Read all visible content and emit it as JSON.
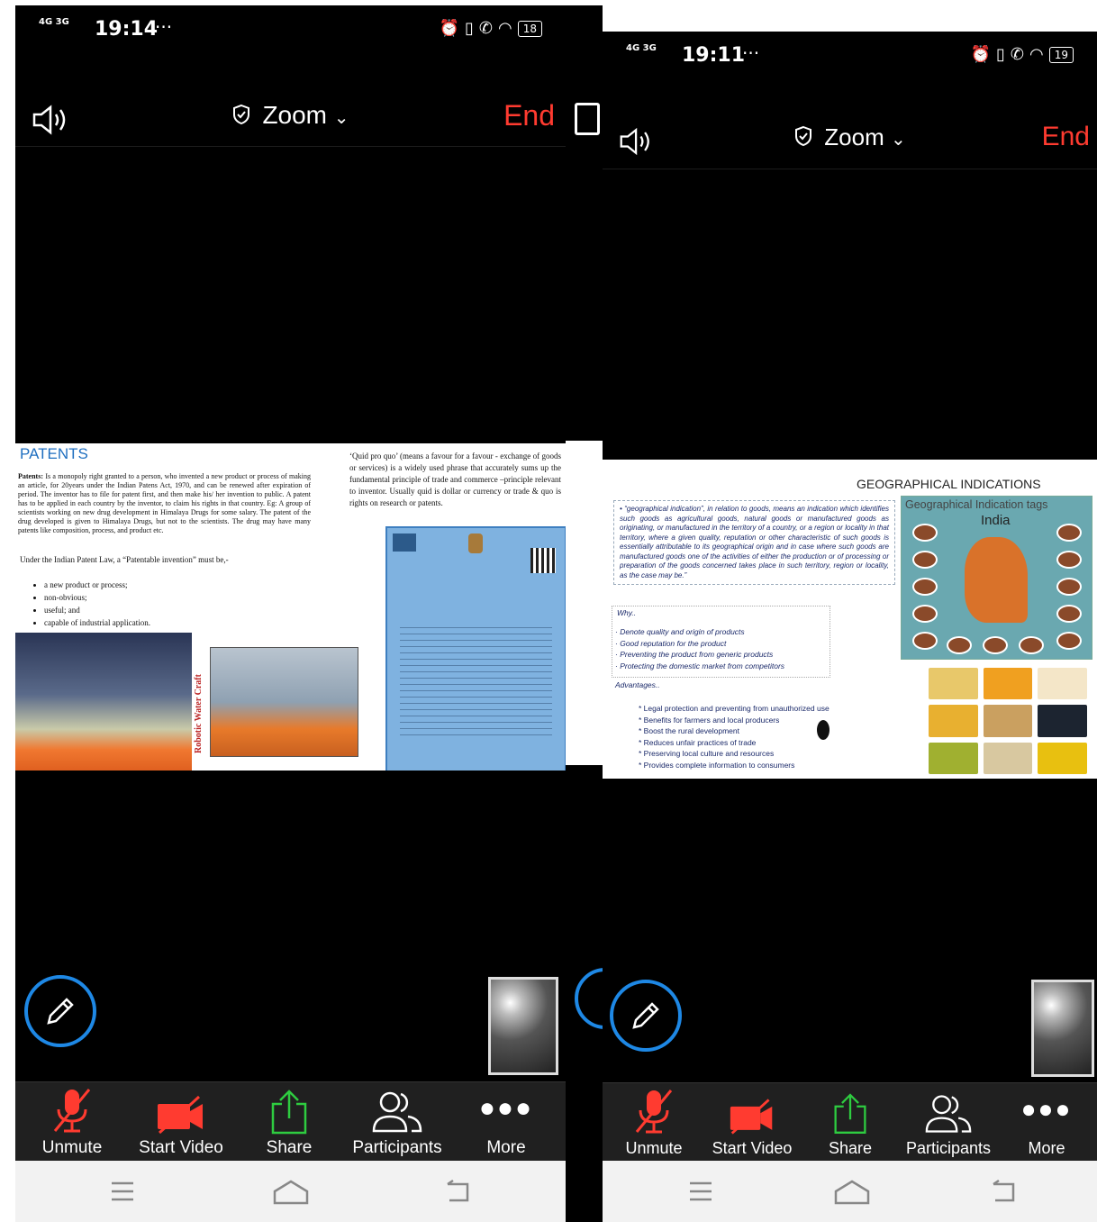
{
  "left_screen": {
    "status": {
      "network": [
        "4G",
        "3G"
      ],
      "time": "19:14",
      "more": "···",
      "battery": "18"
    },
    "meeting": {
      "title": "Zoom",
      "end_label": "End"
    },
    "slide": {
      "title": "PATENTS",
      "paragraph_label": "Patents:",
      "paragraph": "Is a monopoly right granted to a person, who invented a new product or process of making an article, for 20years under the Indian Patens Act, 1970, and can be renewed after expiration of period. The inventor has to file for patent first, and then make his/ her invention to public. A patent has to be applied in each country by the inventor, to claim his rights in that country. Eg: A group of scientists working on new drug development in Himalaya Drugs for some salary. The patent of the drug developed is given to Himalaya Drugs, but not to the scientists. The drug may have many patents like composition, process, and product etc.",
      "under_text": "Under the Indian Patent Law, a “Patentable invention” must be,-",
      "criteria": [
        "a new product or process;",
        "non-obvious;",
        "useful; and",
        "capable of industrial application."
      ],
      "quote": "‘Quid pro quo’ (means a favour for a favour - exchange of goods or services) is a widely used phrase that accurately sums up the fundamental principle of trade and commerce –principle relevant to inventor. Usually quid is dollar or currency or trade & quo is rights on research or patents.",
      "photo_caption": "Robotic Water Craft"
    },
    "toolbar": {
      "unmute": "Unmute",
      "start_video": "Start Video",
      "share": "Share",
      "participants": "Participants",
      "more": "More"
    }
  },
  "right_screen": {
    "status": {
      "network": [
        "4G",
        "3G"
      ],
      "time": "19:11",
      "more": "···",
      "battery": "19"
    },
    "meeting": {
      "title": "Zoom",
      "end_label": "End"
    },
    "slide": {
      "title": "GEOGRAPHICAL INDICATIONS",
      "definition": "• “geographical indication”, in relation to goods, means an indication which identifies such goods as agricultural goods, natural goods or manufactured goods as originating, or manufactured in the territory of a country, or a region or locality in that territory, where a given quality, reputation or other characteristic of such goods is essentially attributable to its geographical origin and in case where such goods are manufactured goods one of the activities of either the production or of processing or preparation of the goods concerned takes place in such territory, region or locality, as the case may be.”",
      "why_label": "Why..",
      "why_items": [
        "Denote quality and origin of products",
        "Good reputation for the product",
        "Preventing the product from generic products",
        "Protecting the domestic market from competitors"
      ],
      "advantages_label": "Advantages..",
      "advantages": [
        "Legal protection and preventing from unauthorized use",
        "Benefits for farmers and local producers",
        "Boost the rural development",
        "Reduces unfair practices of trade",
        "Preserving local culture and resources",
        "Provides complete information to consumers"
      ],
      "map_title": "Geographical Indication tags",
      "map_subtitle": "India",
      "food_colors": [
        "#e8c86a",
        "#f0a020",
        "#f4e6c8",
        "#e8b030",
        "#caa060",
        "#1c2430",
        "#a0b030",
        "#d8c8a0",
        "#e8c010"
      ]
    },
    "toolbar": {
      "unmute": "Unmute",
      "start_video": "Start Video",
      "share": "Share",
      "participants": "Participants",
      "more": "More"
    }
  },
  "colors": {
    "end": "#ff3b30",
    "muted": "#ff3b30",
    "share": "#2ecc40",
    "pen_ring": "#1e88e5",
    "patents_title": "#1f6fc0"
  }
}
